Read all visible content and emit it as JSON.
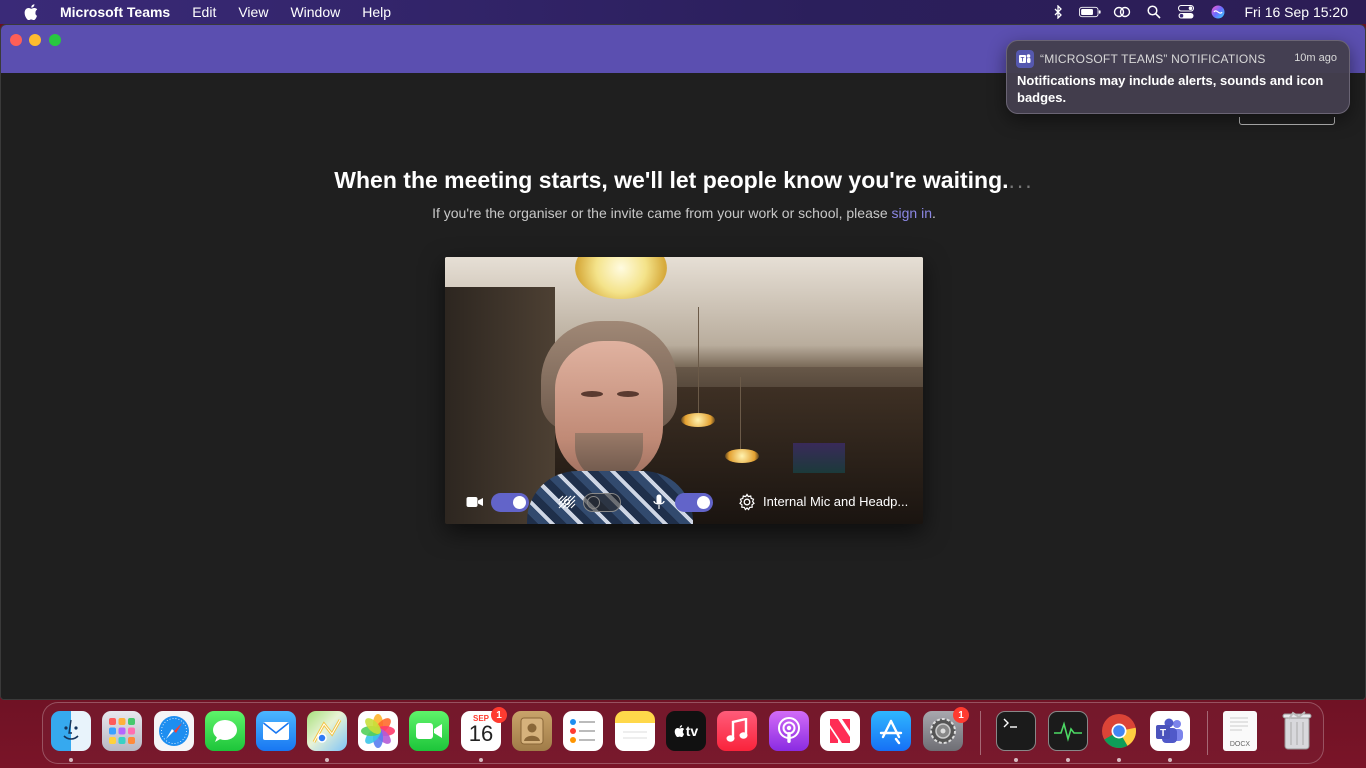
{
  "menubar": {
    "apple_icon": "apple-logo-icon",
    "app_name": "Microsoft Teams",
    "menus": [
      "Edit",
      "View",
      "Window",
      "Help"
    ],
    "status_icons": [
      "bluetooth-icon",
      "battery-icon",
      "screen-mirroring-icon",
      "spotlight-search-icon",
      "control-center-icon",
      "siri-icon"
    ],
    "clock": "Fri 16 Sep  15:20"
  },
  "window": {
    "title_bar_color": "#5b4fb0",
    "headline": "When the meeting starts, we'll let people know you're waiting.",
    "headline_dots": "...",
    "subline_prefix": "If you're the organiser or the invite came from your work or school, please ",
    "sign_in_link": "sign in",
    "subline_suffix": "."
  },
  "preview": {
    "camera_on": true,
    "background_effects_on": false,
    "mic_on": true,
    "audio_device": "Internal Mic and Headp...",
    "accent_color": "#6264c9"
  },
  "notification": {
    "app_name": "“MICROSOFT TEAMS” NOTIFICATIONS",
    "time": "10m ago",
    "body": "Notifications may include alerts, sounds and icon badges."
  },
  "dock": {
    "calendar_month": "SEP",
    "calendar_day": "16",
    "calendar_badge": "1",
    "settings_badge": "1",
    "tv_label": "tv",
    "docx_label": "DOCX"
  }
}
